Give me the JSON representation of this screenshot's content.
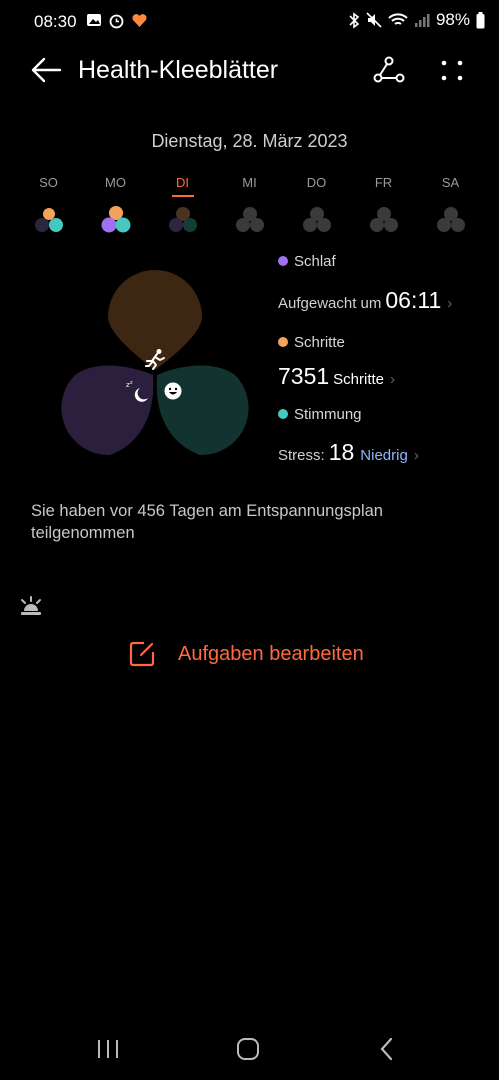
{
  "status_bar": {
    "time": "08:30",
    "battery": "98%"
  },
  "header": {
    "title": "Health-Kleeblätter"
  },
  "date": "Dienstag, 28. März 2023",
  "week": [
    {
      "label": "SO",
      "active": false
    },
    {
      "label": "MO",
      "active": false
    },
    {
      "label": "DI",
      "active": true
    },
    {
      "label": "MI",
      "active": false
    },
    {
      "label": "DO",
      "active": false
    },
    {
      "label": "FR",
      "active": false
    },
    {
      "label": "SA",
      "active": false
    }
  ],
  "legend": {
    "sleep_label": "Schlaf",
    "woke_prefix": "Aufgewacht um",
    "woke_time": "06:11",
    "steps_label": "Schritte",
    "steps_value": "7351",
    "steps_unit": "Schritte",
    "mood_label": "Stimmung",
    "stress_prefix": "Stress:",
    "stress_value": "18",
    "stress_level": "Niedrig"
  },
  "info_text": "Sie haben vor 456 Tagen am Entspannungsplan teilgenommen",
  "action": {
    "edit_tasks": "Aufgaben bearbeiten"
  },
  "colors": {
    "accent": "#ff6a3d",
    "sleep": "#a070f0",
    "steps": "#f5a25a",
    "mood": "#46c7c0"
  }
}
